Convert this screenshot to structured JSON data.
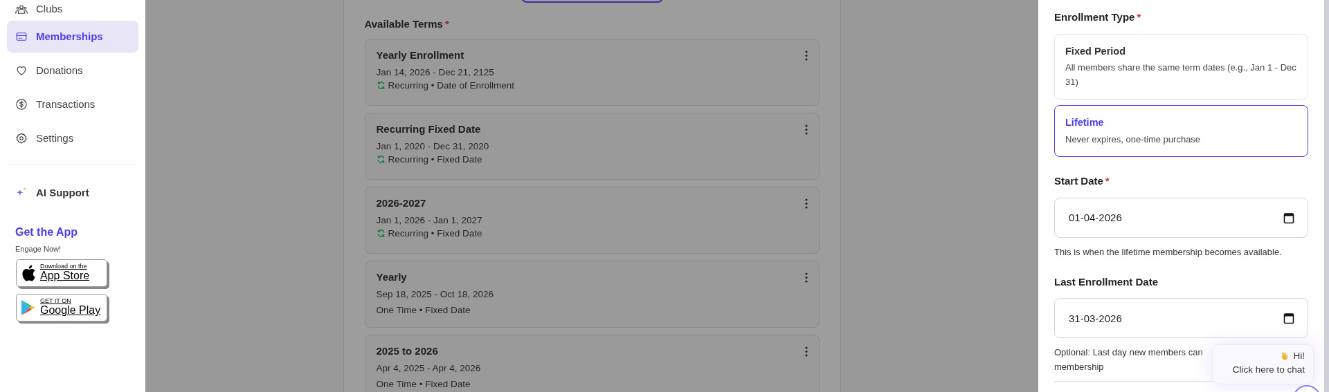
{
  "sidebar": {
    "items": [
      {
        "label": "Clubs",
        "kind": "clubs",
        "selected": false
      },
      {
        "label": "Memberships",
        "kind": "memberships",
        "selected": true
      },
      {
        "label": "Donations",
        "kind": "donations",
        "selected": false
      },
      {
        "label": "Transactions",
        "kind": "transactions",
        "selected": false
      },
      {
        "label": "Settings",
        "kind": "settings",
        "selected": false
      }
    ],
    "ai_support": {
      "label": "AI Support"
    },
    "get_app": {
      "title": "Get the App",
      "subtitle": "Engage Now!",
      "stores": [
        {
          "kind": "apple",
          "line1": "Download on the",
          "line2": "App Store"
        },
        {
          "kind": "google",
          "line1": "GET IT ON",
          "line2": "Google Play"
        }
      ]
    }
  },
  "terms": {
    "label": "Available Terms",
    "required_mark": "*",
    "items": [
      {
        "name": "Yearly Enrollment",
        "dates": "Jan 14, 2026 - Dec 21, 2125",
        "recurring": true,
        "schedule": "Recurring • Date of Enrollment"
      },
      {
        "name": "Recurring Fixed Date",
        "dates": "Jan 1, 2020 - Dec 31, 2020",
        "recurring": true,
        "schedule": "Recurring • Fixed Date"
      },
      {
        "name": "2026-2027",
        "dates": "Jan 1, 2026 - Jan 1, 2027",
        "recurring": true,
        "schedule": "Recurring • Fixed Date"
      },
      {
        "name": "Yearly",
        "dates": "Sep 18, 2025 - Oct 18, 2026",
        "recurring": false,
        "schedule": "One Time • Fixed Date"
      },
      {
        "name": "2025 to 2026",
        "dates": "Apr 4, 2025 - Apr 4, 2026",
        "recurring": false,
        "schedule": "One Time • Fixed Date"
      }
    ]
  },
  "drawer": {
    "enrollment_type": {
      "label": "Enrollment Type",
      "required_mark": "*",
      "options": [
        {
          "title": "Fixed Period",
          "description": "All members share the same term dates (e.g., Jan 1 - Dec 31)",
          "selected": false
        },
        {
          "title": "Lifetime",
          "description": "Never expires, one-time purchase",
          "selected": true
        }
      ]
    },
    "start_date": {
      "label": "Start Date",
      "required_mark": "*",
      "value": "01-04-2026",
      "help": "This is when the lifetime membership becomes available."
    },
    "last_enrollment_date": {
      "label": "Last Enrollment Date",
      "value": "31-03-2026",
      "help": "Optional: Last day new members can"
    },
    "help_continued": "membership"
  },
  "chat": {
    "greeting": "Hi!",
    "text": "Click here to chat"
  }
}
